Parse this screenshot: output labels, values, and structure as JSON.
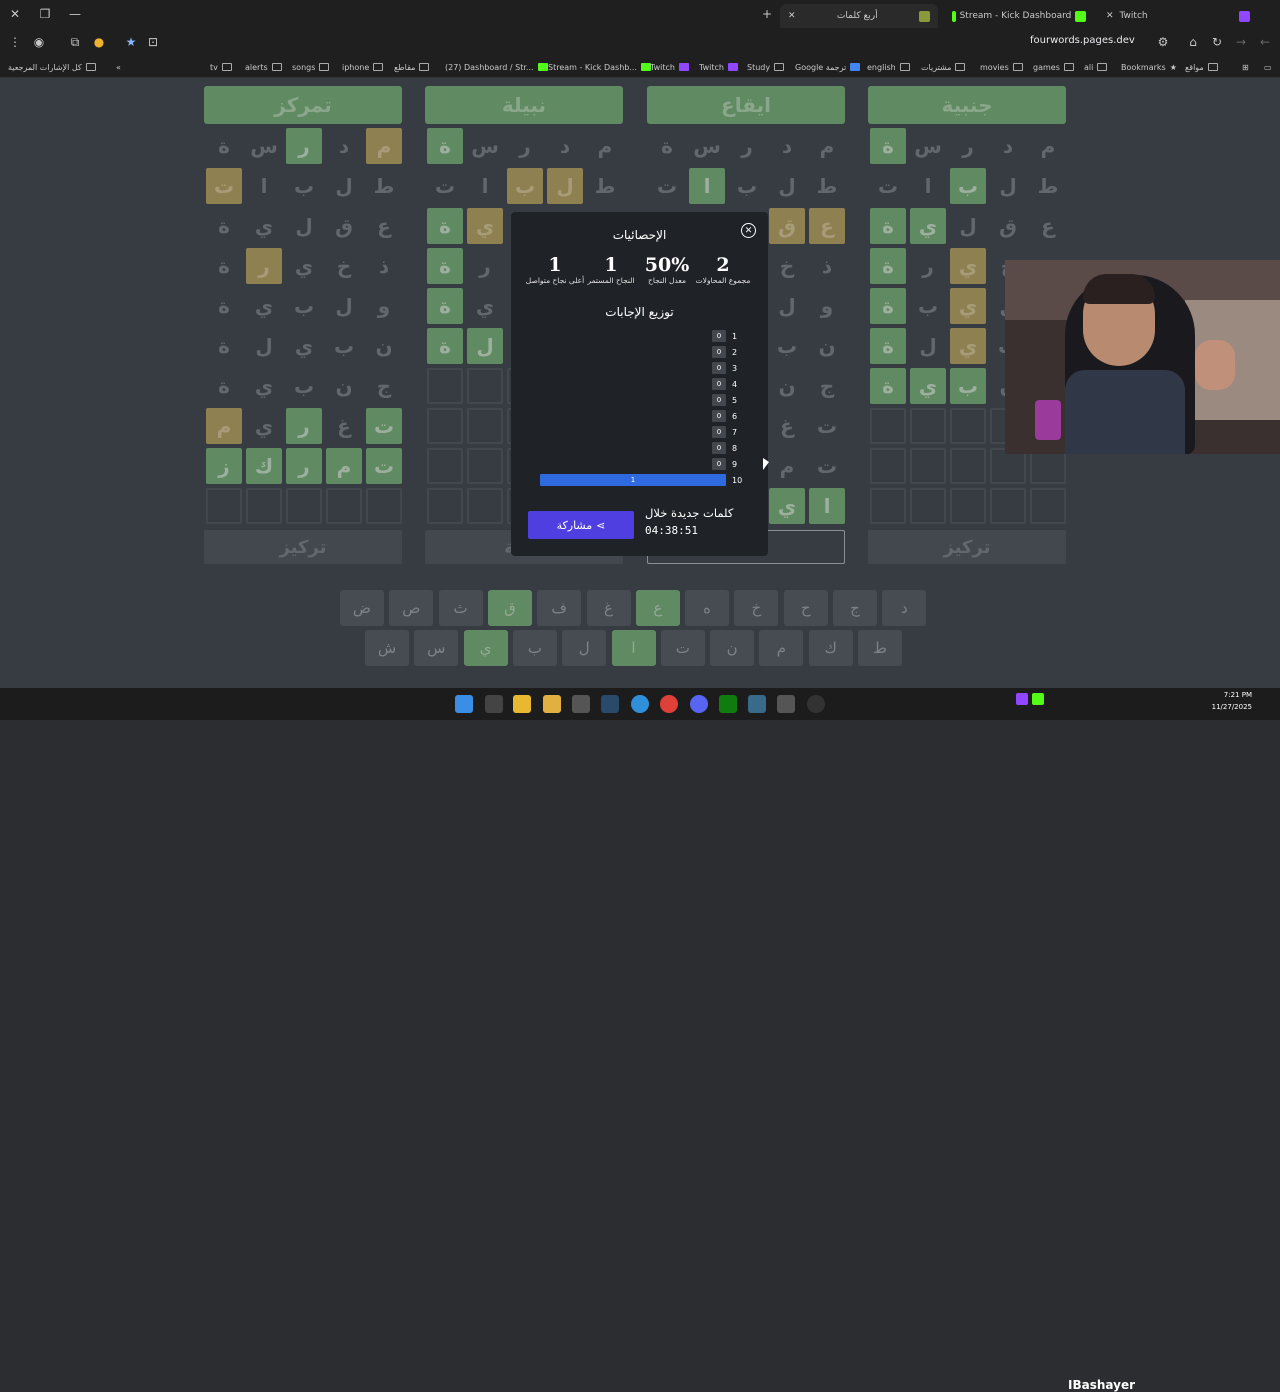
{
  "browser": {
    "tabs": [
      {
        "label": "أربع كلمات",
        "active": true
      },
      {
        "label": "Stream - Kick Dashboard",
        "active": false
      },
      {
        "label": "Twitch",
        "active": false
      }
    ],
    "url": "fourwords.pages.dev",
    "bookmarks": [
      "كل الإشارات المرجعية",
      "tv",
      "alerts",
      "songs",
      "iphone",
      "مقاطع",
      "(27) Dashboard / Str...",
      "Stream - Kick Dashb...",
      "Twitch",
      "Twitch",
      "Study",
      "Google ترجمة",
      "english",
      "مشتريات",
      "movies",
      "games",
      "ali",
      "Bookmarks",
      "مواقع"
    ]
  },
  "boards": [
    {
      "word": "تمركز",
      "rows": [
        [
          [
            "م",
            "y"
          ],
          [
            "د",
            ""
          ],
          [
            "ر",
            "g"
          ],
          [
            "س",
            ""
          ],
          [
            "ة",
            ""
          ]
        ],
        [
          [
            "ط",
            ""
          ],
          [
            "ل",
            ""
          ],
          [
            "ب",
            ""
          ],
          [
            "ا",
            ""
          ],
          [
            "ت",
            "y"
          ]
        ],
        [
          [
            "ع",
            ""
          ],
          [
            "ق",
            ""
          ],
          [
            "ل",
            ""
          ],
          [
            "ي",
            ""
          ],
          [
            "ة",
            ""
          ]
        ],
        [
          [
            "ذ",
            ""
          ],
          [
            "خ",
            ""
          ],
          [
            "ي",
            ""
          ],
          [
            "ر",
            "y"
          ],
          [
            "ة",
            ""
          ]
        ],
        [
          [
            "و",
            ""
          ],
          [
            "ل",
            ""
          ],
          [
            "ب",
            ""
          ],
          [
            "ي",
            ""
          ],
          [
            "ة",
            ""
          ]
        ],
        [
          [
            "ن",
            ""
          ],
          [
            "ب",
            ""
          ],
          [
            "ي",
            ""
          ],
          [
            "ل",
            ""
          ],
          [
            "ة",
            ""
          ]
        ],
        [
          [
            "ج",
            ""
          ],
          [
            "ن",
            ""
          ],
          [
            "ب",
            ""
          ],
          [
            "ي",
            ""
          ],
          [
            "ة",
            ""
          ]
        ],
        [
          [
            "ت",
            "g"
          ],
          [
            "غ",
            ""
          ],
          [
            "ر",
            "g"
          ],
          [
            "ي",
            ""
          ],
          [
            "م",
            "y"
          ]
        ],
        [
          [
            "ت",
            "g"
          ],
          [
            "م",
            "g"
          ],
          [
            "ر",
            "g"
          ],
          [
            "ك",
            "g"
          ],
          [
            "ز",
            "g"
          ]
        ],
        [
          [
            "",
            "e"
          ],
          [
            "",
            "e"
          ],
          [
            "",
            "e"
          ],
          [
            "",
            "e"
          ],
          [
            "",
            "e"
          ]
        ]
      ],
      "footer": "تركيز"
    },
    {
      "word": "نبيلة",
      "rows": [
        [
          [
            "م",
            ""
          ],
          [
            "د",
            ""
          ],
          [
            "ر",
            ""
          ],
          [
            "س",
            ""
          ],
          [
            "ة",
            "g"
          ]
        ],
        [
          [
            "ط",
            ""
          ],
          [
            "ل",
            "y"
          ],
          [
            "ب",
            "y"
          ],
          [
            "ا",
            ""
          ],
          [
            "ت",
            ""
          ]
        ],
        [
          [
            "ع",
            ""
          ],
          [
            "ق",
            ""
          ],
          [
            "ل",
            ""
          ],
          [
            "ي",
            "y"
          ],
          [
            "ة",
            "g"
          ]
        ],
        [
          [
            "ذ",
            ""
          ],
          [
            "خ",
            ""
          ],
          [
            "ي",
            ""
          ],
          [
            "ر",
            ""
          ],
          [
            "ة",
            "g"
          ]
        ],
        [
          [
            "و",
            ""
          ],
          [
            "ل",
            ""
          ],
          [
            "ب",
            ""
          ],
          [
            "ي",
            ""
          ],
          [
            "ة",
            "g"
          ]
        ],
        [
          [
            "ن",
            ""
          ],
          [
            "ب",
            ""
          ],
          [
            "ي",
            ""
          ],
          [
            "ل",
            "g"
          ],
          [
            "ة",
            "g"
          ]
        ],
        [
          [
            "",
            "e"
          ],
          [
            "",
            "e"
          ],
          [
            "",
            "e"
          ],
          [
            "",
            "e"
          ],
          [
            "",
            "e"
          ]
        ],
        [
          [
            "",
            "e"
          ],
          [
            "",
            "e"
          ],
          [
            "",
            "e"
          ],
          [
            "",
            "e"
          ],
          [
            "",
            "e"
          ]
        ],
        [
          [
            "",
            "e"
          ],
          [
            "",
            "e"
          ],
          [
            "",
            "e"
          ],
          [
            "",
            "e"
          ],
          [
            "",
            "e"
          ]
        ],
        [
          [
            "",
            "e"
          ],
          [
            "",
            "e"
          ],
          [
            "",
            "e"
          ],
          [
            "",
            "e"
          ],
          [
            "",
            "e"
          ]
        ]
      ],
      "footer": "نبيلة"
    },
    {
      "word": "ايقاع",
      "rows": [
        [
          [
            "م",
            ""
          ],
          [
            "د",
            ""
          ],
          [
            "ر",
            ""
          ],
          [
            "س",
            ""
          ],
          [
            "ة",
            ""
          ]
        ],
        [
          [
            "ط",
            ""
          ],
          [
            "ل",
            ""
          ],
          [
            "ب",
            ""
          ],
          [
            "ا",
            "g"
          ],
          [
            "ت",
            ""
          ]
        ],
        [
          [
            "ع",
            "y"
          ],
          [
            "ق",
            "y"
          ],
          [
            "ل",
            ""
          ],
          [
            "ي",
            ""
          ],
          [
            "ة",
            ""
          ]
        ],
        [
          [
            "ذ",
            ""
          ],
          [
            "خ",
            ""
          ],
          [
            "ي",
            ""
          ],
          [
            "ر",
            ""
          ],
          [
            "ة",
            ""
          ]
        ],
        [
          [
            "و",
            ""
          ],
          [
            "ل",
            ""
          ],
          [
            "ب",
            ""
          ],
          [
            "ي",
            ""
          ],
          [
            "ة",
            ""
          ]
        ],
        [
          [
            "ن",
            ""
          ],
          [
            "ب",
            ""
          ],
          [
            "ي",
            ""
          ],
          [
            "ل",
            ""
          ],
          [
            "ة",
            ""
          ]
        ],
        [
          [
            "ج",
            ""
          ],
          [
            "ن",
            ""
          ],
          [
            "ب",
            ""
          ],
          [
            "ي",
            ""
          ],
          [
            "ة",
            ""
          ]
        ],
        [
          [
            "ت",
            ""
          ],
          [
            "غ",
            ""
          ],
          [
            "ر",
            ""
          ],
          [
            "ي",
            ""
          ],
          [
            "م",
            ""
          ]
        ],
        [
          [
            "ت",
            ""
          ],
          [
            "م",
            ""
          ],
          [
            "ر",
            ""
          ],
          [
            "ك",
            ""
          ],
          [
            "ز",
            ""
          ]
        ],
        [
          [
            "ا",
            "g"
          ],
          [
            "ي",
            "g"
          ],
          [
            "",
            "e"
          ],
          [
            "",
            "e"
          ],
          [
            "",
            "e"
          ]
        ]
      ],
      "footer": ""
    },
    {
      "word": "جنبية",
      "rows": [
        [
          [
            "م",
            ""
          ],
          [
            "د",
            ""
          ],
          [
            "ر",
            ""
          ],
          [
            "س",
            ""
          ],
          [
            "ة",
            "g"
          ]
        ],
        [
          [
            "ط",
            ""
          ],
          [
            "ل",
            ""
          ],
          [
            "ب",
            "g"
          ],
          [
            "ا",
            ""
          ],
          [
            "ت",
            ""
          ]
        ],
        [
          [
            "ع",
            ""
          ],
          [
            "ق",
            ""
          ],
          [
            "ل",
            ""
          ],
          [
            "ي",
            "g"
          ],
          [
            "ة",
            "g"
          ]
        ],
        [
          [
            "ذ",
            ""
          ],
          [
            "خ",
            ""
          ],
          [
            "ي",
            "y"
          ],
          [
            "ر",
            ""
          ],
          [
            "ة",
            "g"
          ]
        ],
        [
          [
            "و",
            ""
          ],
          [
            "ل",
            ""
          ],
          [
            "ي",
            "y"
          ],
          [
            "ب",
            ""
          ],
          [
            "ة",
            "g"
          ]
        ],
        [
          [
            "ن",
            ""
          ],
          [
            "ب",
            ""
          ],
          [
            "ي",
            "y"
          ],
          [
            "ل",
            ""
          ],
          [
            "ة",
            "g"
          ]
        ],
        [
          [
            "ج",
            ""
          ],
          [
            "ن",
            ""
          ],
          [
            "ب",
            "g"
          ],
          [
            "ي",
            "g"
          ],
          [
            "ة",
            "g"
          ]
        ],
        [
          [
            "",
            "e"
          ],
          [
            "",
            "e"
          ],
          [
            "",
            "e"
          ],
          [
            "",
            "e"
          ],
          [
            "",
            "e"
          ]
        ],
        [
          [
            "",
            "e"
          ],
          [
            "",
            "e"
          ],
          [
            "",
            "e"
          ],
          [
            "",
            "e"
          ],
          [
            "",
            "e"
          ]
        ],
        [
          [
            "",
            "e"
          ],
          [
            "",
            "e"
          ],
          [
            "",
            "e"
          ],
          [
            "",
            "e"
          ],
          [
            "",
            "e"
          ]
        ]
      ],
      "footer": "تركيز"
    }
  ],
  "keyboard": {
    "row1": [
      [
        "ض",
        ""
      ],
      [
        "ص",
        ""
      ],
      [
        "ث",
        ""
      ],
      [
        "ق",
        "g"
      ],
      [
        "ف",
        ""
      ],
      [
        "غ",
        ""
      ],
      [
        "ع",
        "g"
      ],
      [
        "ه",
        ""
      ],
      [
        "خ",
        ""
      ],
      [
        "ح",
        ""
      ],
      [
        "ج",
        ""
      ],
      [
        "د",
        ""
      ]
    ],
    "row2": [
      [
        "ش",
        ""
      ],
      [
        "س",
        ""
      ],
      [
        "ي",
        "g"
      ],
      [
        "ب",
        ""
      ],
      [
        "ل",
        ""
      ],
      [
        "ا",
        "g"
      ],
      [
        "ت",
        ""
      ],
      [
        "ن",
        ""
      ],
      [
        "م",
        ""
      ],
      [
        "ك",
        ""
      ],
      [
        "ط",
        ""
      ]
    ]
  },
  "stats": {
    "title": "الإحصائيات",
    "items": [
      {
        "value": "2",
        "label": "مجموع المحاولات"
      },
      {
        "value": "50%",
        "label": "معدل النجاح"
      },
      {
        "value": "1",
        "label": "النجاح المستمر"
      },
      {
        "value": "1",
        "label": "أعلى نجاح متواصل"
      }
    ],
    "distribution_title": "توزيع الإجابات",
    "distribution": [
      {
        "guess": "1",
        "count": 0
      },
      {
        "guess": "2",
        "count": 0
      },
      {
        "guess": "3",
        "count": 0
      },
      {
        "guess": "4",
        "count": 0
      },
      {
        "guess": "5",
        "count": 0
      },
      {
        "guess": "6",
        "count": 0
      },
      {
        "guess": "7",
        "count": 0
      },
      {
        "guess": "8",
        "count": 0
      },
      {
        "guess": "9",
        "count": 0
      },
      {
        "guess": "10",
        "count": 1
      }
    ],
    "next_label": "كلمات جديدة خلال",
    "countdown": "04:38:51",
    "share_label": "مشاركة"
  },
  "taskbar": {
    "streamer": "IBashayer",
    "time": "7:21 PM",
    "date": "11/27/2025"
  },
  "colors": {
    "correct": "#5f8a62",
    "present": "#8f8052",
    "share": "#4f3fe0",
    "dist_highlight": "#2f6ae0"
  }
}
